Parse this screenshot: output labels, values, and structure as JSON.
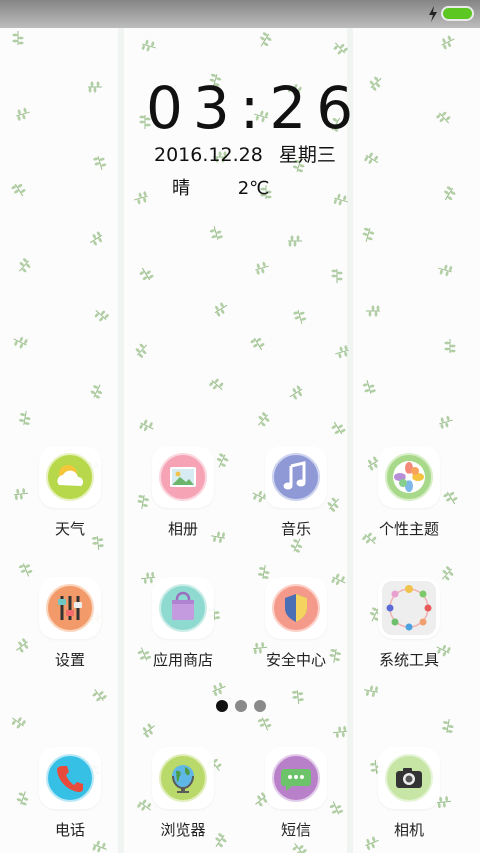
{
  "status_bar": {
    "charging_icon": "lightning-icon",
    "battery_color": "#5cc721"
  },
  "lock_clock": {
    "time": "03:26",
    "date": "2016.12.28",
    "weekday": "星期三"
  },
  "weather": {
    "condition": "晴",
    "temperature": "2℃"
  },
  "apps": [
    {
      "label": "天气",
      "icon": "weather-icon",
      "color": "#b7d84a"
    },
    {
      "label": "相册",
      "icon": "gallery-icon",
      "color": "#f6a3b6"
    },
    {
      "label": "音乐",
      "icon": "music-icon",
      "color": "#8e99d6"
    },
    {
      "label": "个性主题",
      "icon": "theme-flower-icon",
      "color": "#a8d88a"
    },
    {
      "label": "设置",
      "icon": "settings-sliders-icon",
      "color": "#f39a6b"
    },
    {
      "label": "应用商店",
      "icon": "store-bag-icon",
      "color": "#8fdad0"
    },
    {
      "label": "安全中心",
      "icon": "shield-icon",
      "color": "#f59a8a"
    },
    {
      "label": "系统工具",
      "icon": "tools-icon",
      "color": "#eeeeee"
    }
  ],
  "page_indicator": {
    "count": 3,
    "active": 0
  },
  "dock": [
    {
      "label": "电话",
      "icon": "phone-icon",
      "color": "#37c0e6"
    },
    {
      "label": "浏览器",
      "icon": "browser-globe-icon",
      "color": "#b9d96a"
    },
    {
      "label": "短信",
      "icon": "message-icon",
      "color": "#b880c8"
    },
    {
      "label": "相机",
      "icon": "camera-icon",
      "color": "#c7e6a6"
    }
  ]
}
